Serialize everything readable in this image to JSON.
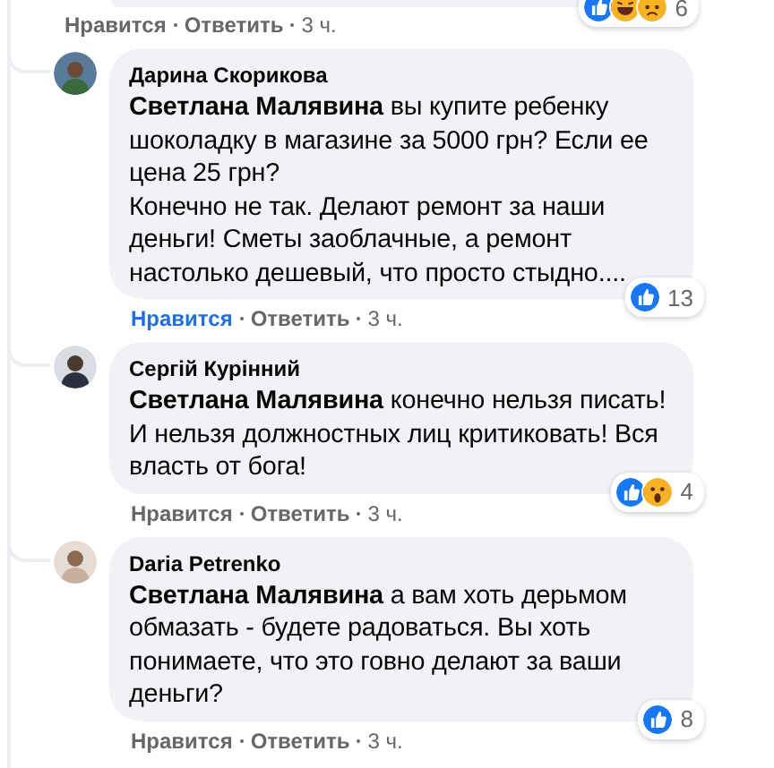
{
  "previous_comment": {
    "reactions": [
      {
        "kind": "like"
      },
      {
        "kind": "haha"
      },
      {
        "kind": "sad"
      }
    ],
    "reaction_count": "6",
    "actions": {
      "like": "Нравится",
      "reply": "Ответить",
      "time": "3 ч.",
      "liked": false
    }
  },
  "comments": [
    {
      "author": "Дарина Скорикова",
      "text": "**Светлана Малявина** вы купите ребенку шоколадку в магазине за 5000 грн? Если ее цена 25 грн?\nКонечно не так. Делают ремонт за наши деньги! Сметы заоблачные, а ремонт настолько дешевый, что просто стыдно....",
      "reactions": [
        {
          "kind": "like"
        }
      ],
      "reaction_count": "13",
      "actions": {
        "like": "Нравится",
        "reply": "Ответить",
        "time": "3 ч.",
        "liked": true
      }
    },
    {
      "author": "Сергій Курінний",
      "text": "**Светлана Малявина** конечно нельзя писать! И нельзя должностных лиц критиковать! Вся власть от бога!",
      "reactions": [
        {
          "kind": "like"
        },
        {
          "kind": "wow"
        }
      ],
      "reaction_count": "4",
      "actions": {
        "like": "Нравится",
        "reply": "Ответить",
        "time": "3 ч.",
        "liked": false
      }
    },
    {
      "author": "Daria Petrenko",
      "text": "**Светлана Малявина** а вам хоть дерьмом обмазать - будете радоваться. Вы хоть понимаете, что это говно делают за ваши деньги?",
      "reactions": [
        {
          "kind": "like"
        }
      ],
      "reaction_count": "8",
      "actions": {
        "like": "Нравится",
        "reply": "Ответить",
        "time": "3 ч.",
        "liked": false
      }
    }
  ]
}
